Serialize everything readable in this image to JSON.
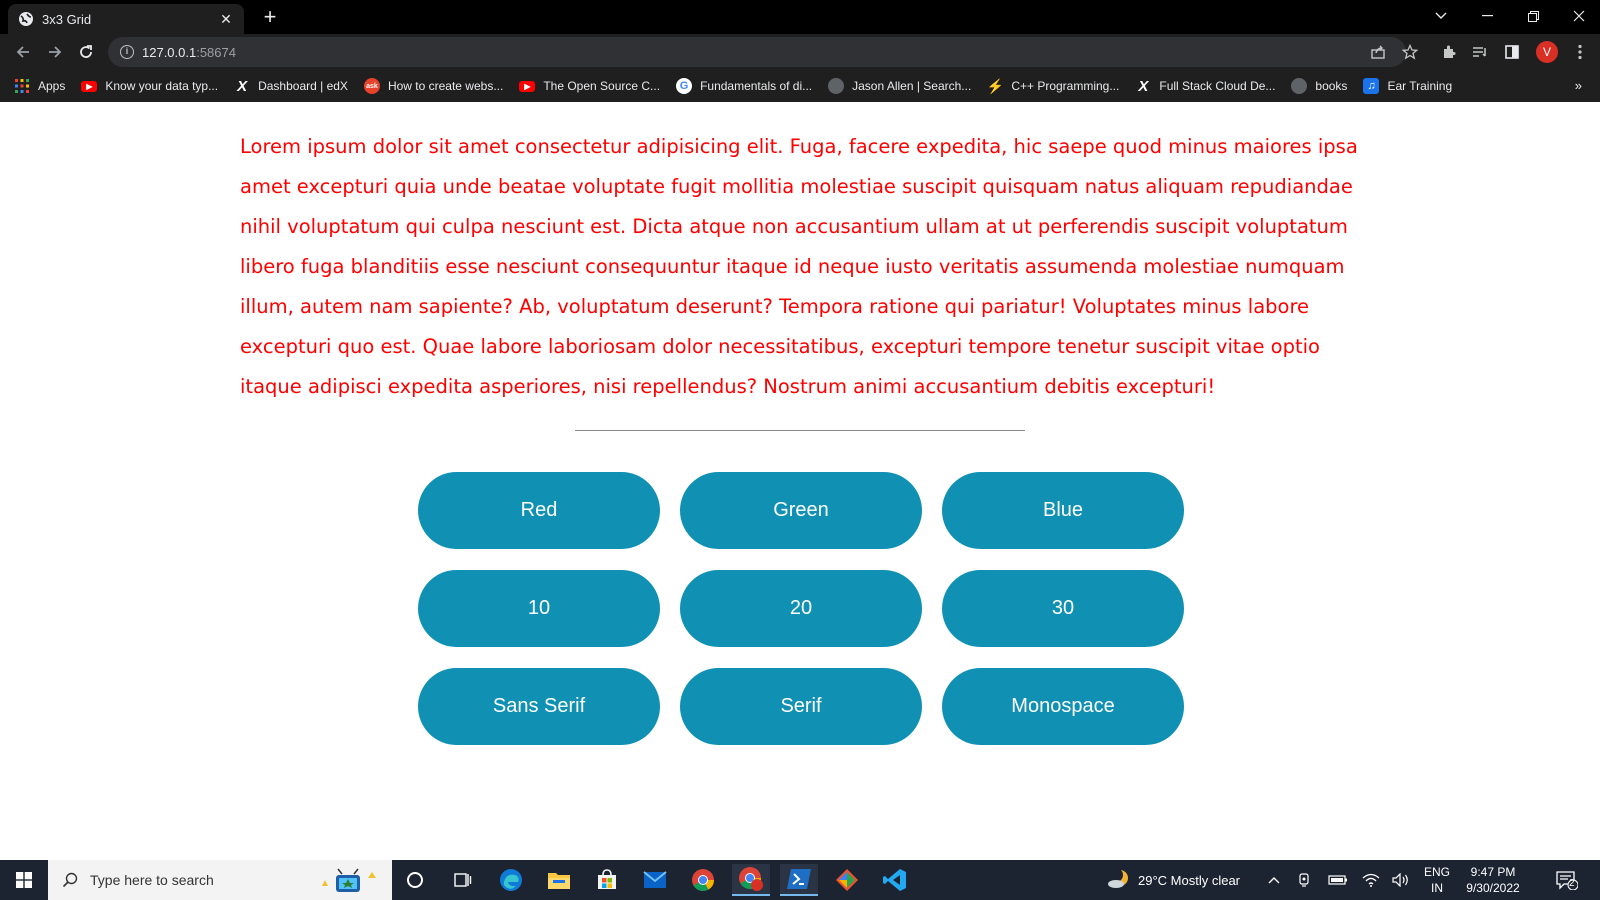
{
  "browser": {
    "tab_title": "3x3 Grid",
    "url_host": "127.0.0.1",
    "url_port": ":58674",
    "avatar_letter": "V",
    "bookmarks": [
      {
        "label": "Apps",
        "icon": "apps-grid-icon"
      },
      {
        "label": "Know your data typ...",
        "icon": "youtube-icon"
      },
      {
        "label": "Dashboard | edX",
        "icon": "edx-icon"
      },
      {
        "label": "How to create webs...",
        "icon": "ask-icon"
      },
      {
        "label": "The Open Source C...",
        "icon": "youtube-icon"
      },
      {
        "label": "Fundamentals of di...",
        "icon": "google-icon"
      },
      {
        "label": "Jason Allen | Search...",
        "icon": "globe-icon"
      },
      {
        "label": "C++ Programming...",
        "icon": "bolt-icon"
      },
      {
        "label": "Full Stack Cloud De...",
        "icon": "edx-icon"
      },
      {
        "label": "books",
        "icon": "globe-icon"
      },
      {
        "label": "Ear Training",
        "icon": "music-icon"
      }
    ]
  },
  "page": {
    "paragraph": "Lorem ipsum dolor sit amet consectetur adipisicing elit. Fuga, facere expedita, hic saepe quod minus maiores ipsa amet excepturi quia unde beatae voluptate fugit mollitia molestiae suscipit quisquam natus aliquam repudiandae nihil voluptatum qui culpa nesciunt est. Dicta atque non accusantium ullam at ut perferendis suscipit voluptatum libero fuga blanditiis esse nesciunt consequuntur itaque id neque iusto veritatis assumenda molestiae numquam illum, autem nam sapiente? Ab, voluptatum deserunt? Tempora ratione qui pariatur! Voluptates minus labore excepturi quo est. Quae labore laboriosam dolor necessitatibus, excepturi tempore tenetur suscipit vitae optio itaque adipisci expedita asperiores, nisi repellendus? Nostrum animi accusantium debitis excepturi!",
    "paragraph_color": "#ff0000",
    "button_color": "#1091b4",
    "buttons": [
      "Red",
      "Green",
      "Blue",
      "10",
      "20",
      "30",
      "Sans Serif",
      "Serif",
      "Monospace"
    ]
  },
  "taskbar": {
    "search_placeholder": "Type here to search",
    "weather": "29°C  Mostly clear",
    "lang_top": "ENG",
    "lang_bottom": "IN",
    "time": "9:47 PM",
    "date": "9/30/2022",
    "notification_count": "2"
  }
}
